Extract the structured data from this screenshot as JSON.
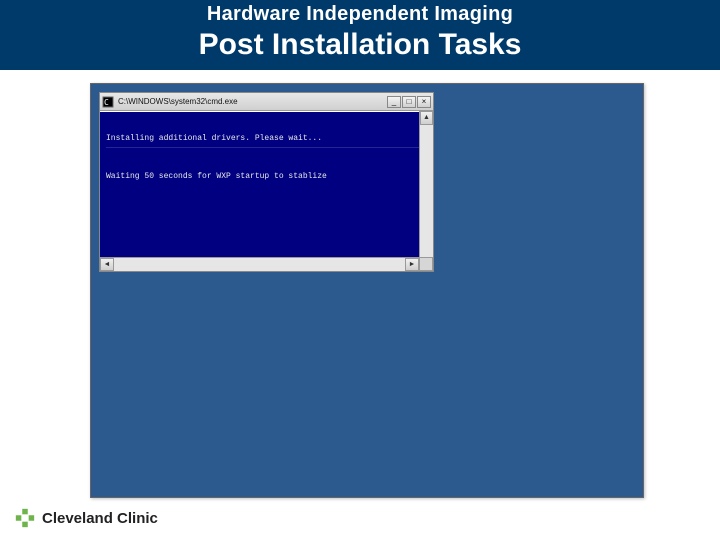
{
  "header": {
    "line1": "Hardware Independent Imaging",
    "line2": "Post Installation Tasks"
  },
  "cmd": {
    "title": "C:\\WINDOWS\\system32\\cmd.exe",
    "line1": "Installing additional drivers. Please wait...",
    "line2": "Waiting 50 seconds for WXP startup to stablize",
    "minimize_glyph": "_",
    "maximize_glyph": "□",
    "close_glyph": "×",
    "up_glyph": "▲",
    "down_glyph": "▼",
    "left_glyph": "◄",
    "right_glyph": "►"
  },
  "footer": {
    "brand": "Cleveland Clinic"
  }
}
